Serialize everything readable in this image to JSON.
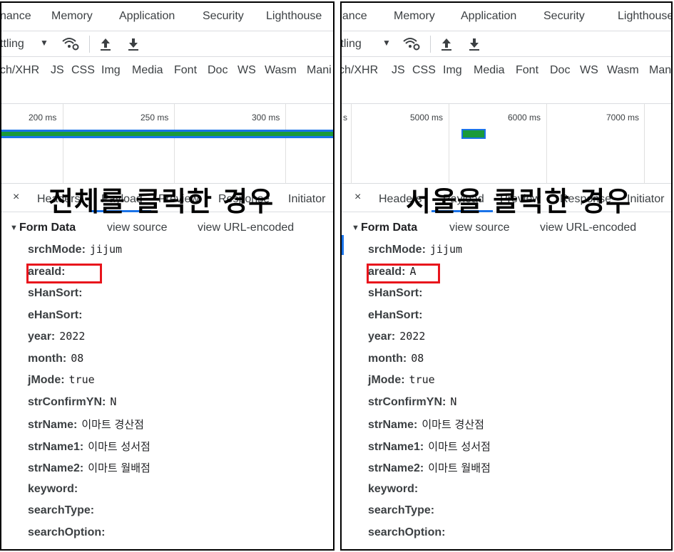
{
  "tabs": [
    "nance",
    "Memory",
    "Application",
    "Security",
    "Lighthouse"
  ],
  "toolbar": {
    "throttle_label": "ttling",
    "dropdown_arrow": "▼"
  },
  "filters": [
    "ch/XHR",
    "JS",
    "CSS",
    "Img",
    "Media",
    "Font",
    "Doc",
    "WS",
    "Wasm",
    "Mani"
  ],
  "left": {
    "timeline_labels": [
      "200 ms",
      "250 ms",
      "300 ms"
    ],
    "overlay_title": "전체를 클릭한 경우",
    "detail_tabs": [
      "Headers",
      "Payload",
      "Preview",
      "Response",
      "Initiator"
    ],
    "close": "×",
    "form_data": {
      "title": "Form Data",
      "view_source": "view source",
      "view_encoded": "view URL-encoded",
      "fields": [
        {
          "key": "srchMode:",
          "value": "jijum"
        },
        {
          "key": "areaId:",
          "value": ""
        },
        {
          "key": "sHanSort:",
          "value": ""
        },
        {
          "key": "eHanSort:",
          "value": ""
        },
        {
          "key": "year:",
          "value": "2022"
        },
        {
          "key": "month:",
          "value": "08"
        },
        {
          "key": "jMode:",
          "value": "true"
        },
        {
          "key": "strConfirmYN:",
          "value": "N"
        },
        {
          "key": "strName:",
          "value": "이마트 경산점"
        },
        {
          "key": "strName1:",
          "value": "이마트 성서점"
        },
        {
          "key": "strName2:",
          "value": "이마트 월배점"
        },
        {
          "key": "keyword:",
          "value": ""
        },
        {
          "key": "searchType:",
          "value": ""
        },
        {
          "key": "searchOption:",
          "value": ""
        }
      ]
    }
  },
  "right": {
    "timeline_labels": [
      "s",
      "5000 ms",
      "6000 ms",
      "7000 ms"
    ],
    "overlay_title": "서울을 클릭한 경우",
    "detail_tabs": [
      "Headers",
      "Payload",
      "Preview",
      "Response",
      "Initiator"
    ],
    "close": "×",
    "form_data": {
      "title": "Form Data",
      "view_source": "view source",
      "view_encoded": "view URL-encoded",
      "fields": [
        {
          "key": "srchMode:",
          "value": "jijum"
        },
        {
          "key": "areaId:",
          "value": "A"
        },
        {
          "key": "sHanSort:",
          "value": ""
        },
        {
          "key": "eHanSort:",
          "value": ""
        },
        {
          "key": "year:",
          "value": "2022"
        },
        {
          "key": "month:",
          "value": "08"
        },
        {
          "key": "jMode:",
          "value": "true"
        },
        {
          "key": "strConfirmYN:",
          "value": "N"
        },
        {
          "key": "strName:",
          "value": "이마트 경산점"
        },
        {
          "key": "strName1:",
          "value": "이마트 성서점"
        },
        {
          "key": "strName2:",
          "value": "이마트 월배점"
        },
        {
          "key": "keyword:",
          "value": ""
        },
        {
          "key": "searchType:",
          "value": ""
        },
        {
          "key": "searchOption:",
          "value": ""
        }
      ]
    }
  },
  "colors": {
    "accent": "#1a73e8",
    "bar": "#1a9a3a",
    "highlight": "#e8141c"
  },
  "icons": [
    "wifi-settings-icon",
    "upload-icon",
    "download-icon",
    "close-icon",
    "triangle-down-icon"
  ]
}
